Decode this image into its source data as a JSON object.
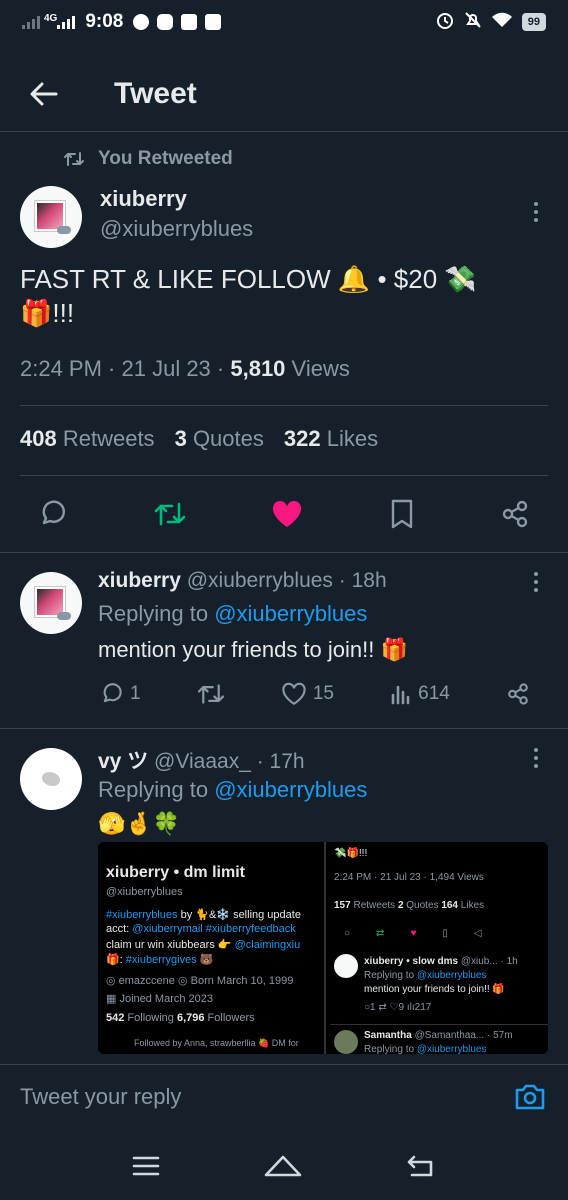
{
  "status_bar": {
    "network": "4G",
    "time": "9:08",
    "battery": "99"
  },
  "header": {
    "title": "Tweet"
  },
  "retweet_label": "You Retweeted",
  "tweet": {
    "name": "xiuberry",
    "handle": "@xiuberryblues",
    "text_line1": "FAST RT & LIKE FOLLOW 🔔 • $20 💸",
    "text_line2": "🎁!!!",
    "time": "2:24 PM",
    "date": "21 Jul 23",
    "views_count": "5,810",
    "views_label": "Views",
    "retweets_count": "408",
    "retweets_label": "Retweets",
    "quotes_count": "3",
    "quotes_label": "Quotes",
    "likes_count": "322",
    "likes_label": "Likes"
  },
  "replies": [
    {
      "name": "xiuberry",
      "handle": "@xiuberryblues",
      "age": "18h",
      "replying_prefix": "Replying to",
      "replying_to": "@xiuberryblues",
      "text": "mention your friends to join!! 🎁",
      "reply_count": "1",
      "like_count": "15",
      "view_count": "614"
    },
    {
      "name": "vy ツ",
      "handle": "@Viaaax_",
      "age": "17h",
      "replying_prefix": "Replying to",
      "replying_to": "@xiuberryblues",
      "text": "🫣🤞🍀"
    }
  ],
  "embed": {
    "profile_name": "xiuberry • dm limit",
    "profile_handle": "@xiuberryblues",
    "bio1_tag": "#xiuberryblues",
    "bio1_rest": " by 🐈&❄️ selling update",
    "bio2_prefix": "acct: ",
    "bio2_links": "@xiuberrymail #xiuberryfeedback",
    "bio3_prefix": "claim ur win xiubbears 👉 ",
    "bio3_link": "@claimingxiu",
    "bio4_prefix": "🎁: ",
    "bio4_link": "#xiuberrygives",
    "bio4_suffix": " 🐻",
    "location": "emazccene",
    "born": "Born March 10, 1999",
    "joined": "Joined March 2023",
    "following_count": "542",
    "following_label": "Following",
    "followers_count": "6,796",
    "followers_label": "Followers",
    "followed_by": "Followed by Anna, strawberllia 🍓 DM for",
    "right_top": "💸🎁!!!",
    "right_meta": "2:24 PM · 21 Jul 23 · 1,494 Views",
    "right_stats_rt": "157",
    "right_stats_rt_label": "Retweets",
    "right_stats_q": "2",
    "right_stats_q_label": "Quotes",
    "right_stats_l": "164",
    "right_stats_l_label": "Likes",
    "right_reply_name": "xiuberry • slow dms",
    "right_reply_handle": "@xiub... · 1h",
    "right_reply_prefix": "Replying to ",
    "right_reply_to": "@xiuberryblues",
    "right_reply_text": "mention your friends to join!! 🎁",
    "right_reply_counts_r": "1",
    "right_reply_counts_l": "9",
    "right_reply_counts_v": "217",
    "right_reply2_name": "Samantha",
    "right_reply2_handle": "@Samanthaa... · 57m",
    "right_reply2_prefix": "Replying to ",
    "right_reply2_to": "@xiuberryblues"
  },
  "reply_bar": {
    "placeholder": "Tweet your reply"
  },
  "colors": {
    "background": "#15202b",
    "accent": "#1d9bf0",
    "retweet_green": "#00ba7c",
    "like_pink": "#f91880",
    "muted": "#8b98a5"
  }
}
